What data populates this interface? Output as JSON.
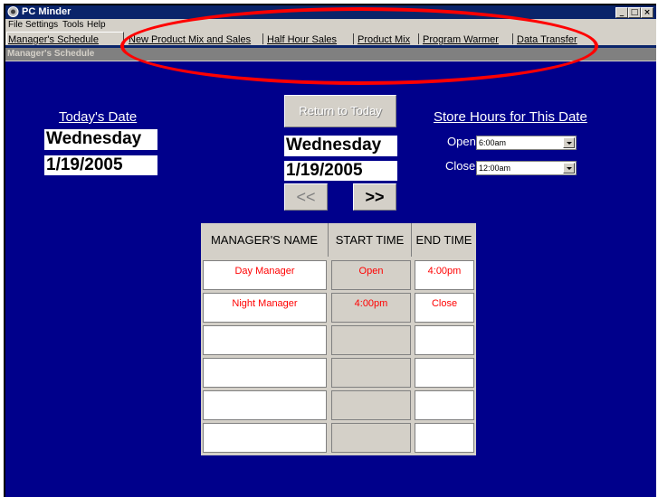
{
  "window": {
    "title": "PC Minder",
    "controls": [
      "_",
      "□",
      "×"
    ]
  },
  "menu": [
    "File",
    "Settings",
    "Tools",
    "Help"
  ],
  "tabs": [
    "Manager's Schedule",
    "New Product Mix and Sales",
    "Half Hour Sales",
    "Product Mix",
    "Program Warmer",
    "Data Transfer"
  ],
  "panel_title": "Manager's Schedule",
  "today": {
    "label": "Today's Date",
    "day": "Wednesday",
    "date": "1/19/2005"
  },
  "selected": {
    "return_label": "Return to Today",
    "day": "Wednesday",
    "date": "1/19/2005",
    "prev_label": "<<",
    "next_label": ">>"
  },
  "store_hours": {
    "label": "Store Hours for This Date",
    "open_label": "Open",
    "open_value": "6:00am",
    "close_label": "Close",
    "close_value": "12:00am"
  },
  "schedule": {
    "headers": [
      "MANAGER'S NAME",
      "START TIME",
      "END TIME"
    ],
    "rows": [
      [
        "Day Manager",
        "Open",
        "4:00pm"
      ],
      [
        "Night Manager",
        "4:00pm",
        "Close"
      ],
      [
        "",
        "",
        ""
      ],
      [
        "",
        "",
        ""
      ],
      [
        "",
        "",
        ""
      ],
      [
        "",
        "",
        ""
      ]
    ]
  },
  "colors": {
    "background": "#00008b",
    "annotation": "#ff0000",
    "cell_text": "#ff0000"
  }
}
